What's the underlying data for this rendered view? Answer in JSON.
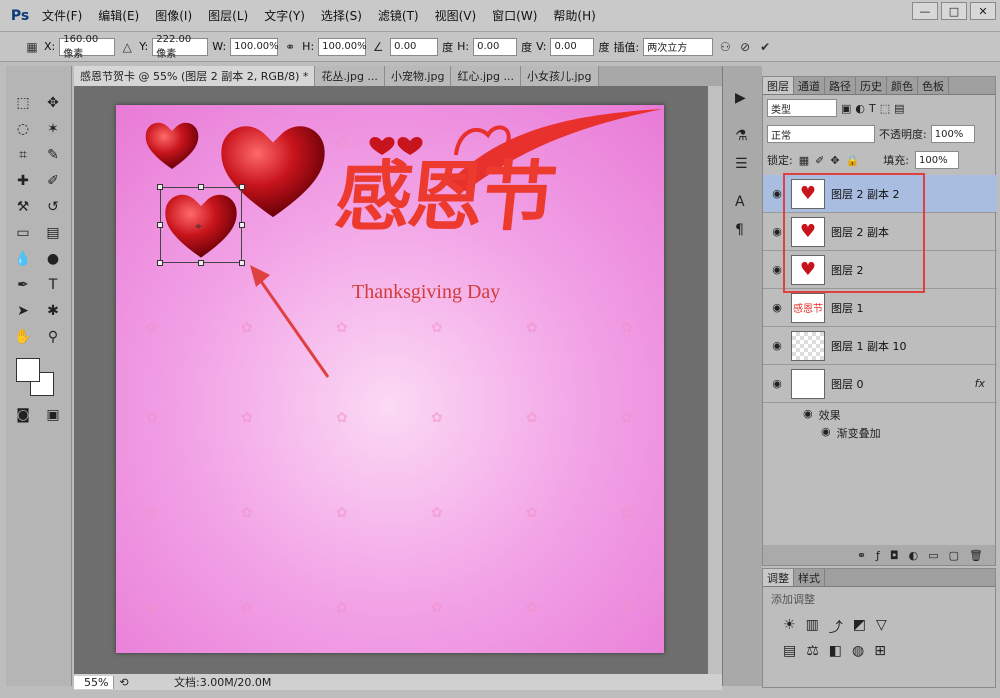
{
  "app": {
    "logo": "Ps"
  },
  "menu": [
    "文件(F)",
    "编辑(E)",
    "图像(I)",
    "图层(L)",
    "文字(Y)",
    "选择(S)",
    "滤镜(T)",
    "视图(V)",
    "窗口(W)",
    "帮助(H)"
  ],
  "window_controls": {
    "minimize": "—",
    "restore": "□",
    "close": "✕"
  },
  "options": {
    "x_label": "X:",
    "x_value": "160.00 像素",
    "y_label": "Y:",
    "y_value": "222.00 像素",
    "w_label": "W:",
    "w_value": "100.00%",
    "h_label": "H:",
    "h_value": "100.00%",
    "angle_value": "0.00",
    "angle_unit": "度",
    "hs_label": "H:",
    "hs_value": "0.00",
    "hs_unit": "度",
    "vs_label": "V:",
    "vs_value": "0.00",
    "vs_unit": "度",
    "interp_label": "插值:",
    "interp_value": "两次立方"
  },
  "tabs": [
    {
      "label": "感恩节贺卡 @ 55% (图层 2 副本 2, RGB/8) *",
      "active": true
    },
    {
      "label": "花丛.jpg ...",
      "active": false
    },
    {
      "label": "小宠物.jpg",
      "active": false
    },
    {
      "label": "红心.jpg ...",
      "active": false
    },
    {
      "label": "小女孩儿.jpg",
      "active": false
    }
  ],
  "canvas": {
    "title_cn": "感恩节",
    "title_en": "Thanksgiving Day"
  },
  "status": {
    "zoom": "55%",
    "doc": "文档:3.00M/20.0M"
  },
  "layers_panel": {
    "tabs": [
      "图层",
      "通道",
      "路径",
      "历史",
      "颜色",
      "色板"
    ],
    "filter_kind": "类型",
    "blend_mode": "正常",
    "opacity_label": "不透明度:",
    "opacity_value": "100%",
    "lock_label": "锁定:",
    "fill_label": "填充:",
    "fill_value": "100%",
    "layers": [
      {
        "name": "图层 2 副本 2",
        "selected": true
      },
      {
        "name": "图层 2 副本",
        "selected": false
      },
      {
        "name": "图层 2",
        "selected": false
      },
      {
        "name": "图层 1",
        "selected": false
      },
      {
        "name": "图层 1 副本 10",
        "selected": false
      },
      {
        "name": "图层 0",
        "selected": false,
        "fx": "fx"
      }
    ],
    "effects_label": "效果",
    "gradient_label": "渐变叠加"
  },
  "adjust_panel": {
    "tabs": [
      "调整",
      "样式"
    ],
    "subtitle": "添加调整"
  },
  "colors": {
    "accent_red": "#cc1f2a",
    "highlight_box": "#e0403f",
    "selected_layer": "#a9bde0"
  }
}
